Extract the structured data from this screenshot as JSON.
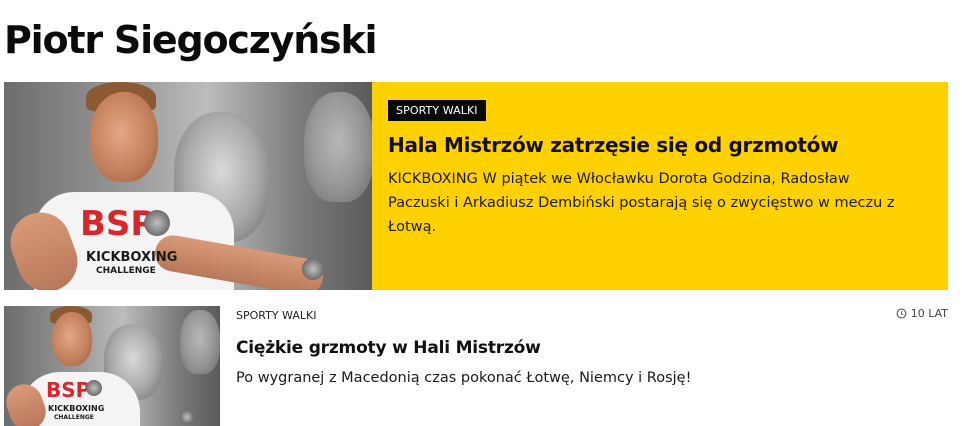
{
  "page": {
    "title": "Piotr Siegoczyński"
  },
  "featured": {
    "category": "SPORTY WALKI",
    "headline": "Hala Mistrzów zatrzęsie się od grzmotów",
    "lead": "KICKBOXING W piątek we Włocławku Dorota Godzina, Radosław Paczuski i Arkadiusz Dembiński postarają się o zwycięstwo w meczu z Łotwą.",
    "image_shirt_text": "KICKBOXING",
    "image_shirt_sub": "CHALLENGE",
    "accent_color": "#ffd100"
  },
  "articles": [
    {
      "category": "SPORTY WALKI",
      "age": "10 LAT",
      "age_icon": "clock-icon",
      "headline": "Ciężkie grzmoty w Hali Mistrzów",
      "lead": "Po wygranej z Macedonią czas pokonać Łotwę, Niemcy i Rosję!",
      "image_shirt_text": "KICKBOXING",
      "image_shirt_sub": "CHALLENGE"
    }
  ]
}
